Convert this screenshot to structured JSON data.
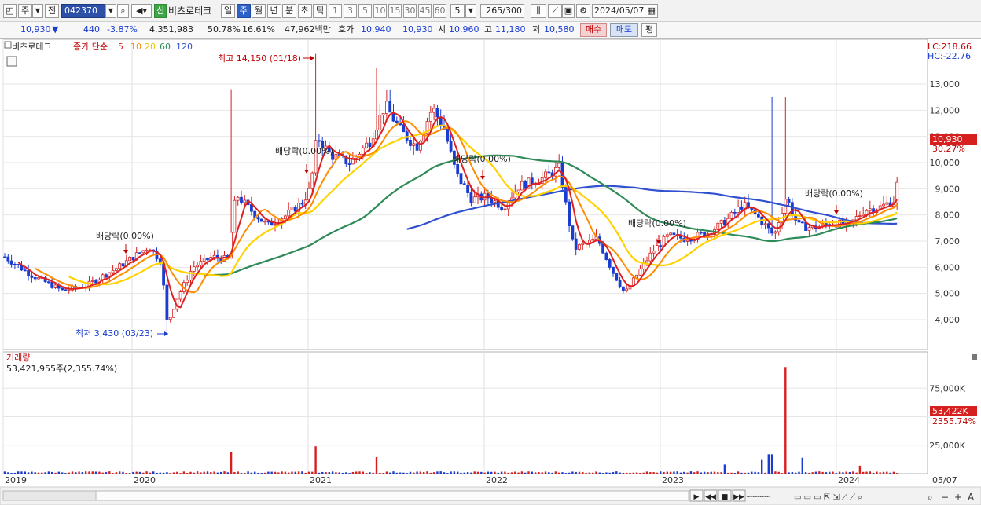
{
  "toolbar": {
    "type_sel": "주",
    "prev_btn": "전",
    "code": "042370",
    "new_badge": "신",
    "stock_name": "비츠로테크",
    "periods": [
      "일",
      "주",
      "월",
      "년",
      "분",
      "초",
      "틱"
    ],
    "active_period": "주",
    "minute_opts": [
      "1",
      "3",
      "5",
      "10",
      "15",
      "30",
      "45",
      "60"
    ],
    "custom_n": "5",
    "count": "265",
    "count_max": "/300",
    "date": "2024/05/07"
  },
  "quote": {
    "price": "10,930",
    "change": "440",
    "change_pct": "-3.87%",
    "volume": "4,351,983",
    "vol_ratio": "50.78%",
    "turnover": "16.61%",
    "amount": "47,962백만",
    "hoga_label": "호가",
    "ask": "10,940",
    "bid": "10,930",
    "open_label": "시",
    "open": "10,960",
    "high_label": "고",
    "high": "11,180",
    "low_label": "저",
    "low": "10,580",
    "buy_btn": "매수",
    "sell_btn": "매도",
    "eval_btn": "평"
  },
  "legend": {
    "name": "비츠로테크",
    "ma_label": "종가 단순",
    "ma_periods": [
      "5",
      "10",
      "20",
      "60",
      "120"
    ],
    "ma_colors": [
      "#e02020",
      "#ff8c00",
      "#ffd200",
      "#2e8b57",
      "#3050d0"
    ]
  },
  "scale": {
    "lc": "LC:218.66",
    "hc": "HC:-22.76"
  },
  "price_axis": [
    "13,000",
    "12,000",
    "11,000",
    "10,000",
    "9,000",
    "8,000",
    "7,000",
    "6,000",
    "5,000",
    "4,000"
  ],
  "price_tag": {
    "value": "10,930",
    "pct": "30.27%"
  },
  "annotations": {
    "high": "최고 14,150 (01/18)",
    "low": "최저 3,430 (03/23)",
    "dividends": [
      "배당락(0.00%)",
      "배당락(0.00%)",
      "배당락(0.00%)",
      "배당락(0.00%)",
      "배당락(0.00%)"
    ]
  },
  "volume": {
    "title": "거래량",
    "value": "53,421,955주(2,355.74%)",
    "axis": [
      "75,000K",
      "50,000K",
      "25,000K"
    ],
    "tag": {
      "value": "53,422K",
      "pct": "2355.74%"
    }
  },
  "x_axis": [
    "2019",
    "2020",
    "2021",
    "2022",
    "2023",
    "2024",
    "05/07"
  ],
  "chart_data": {
    "type": "line",
    "x": [
      "2019-01",
      "2019-06",
      "2019-12",
      "2020-03",
      "2020-06",
      "2020-09",
      "2021-01",
      "2021-06",
      "2021-09",
      "2022-01",
      "2022-06",
      "2022-09",
      "2022-12",
      "2023-03",
      "2023-06",
      "2023-09",
      "2024-01",
      "2024-04",
      "2024-05"
    ],
    "series": [
      {
        "values": [
          6400,
          5200,
          6500,
          3430,
          6200,
          8000,
          14150,
          11500,
          11800,
          8500,
          9300,
          5000,
          6500,
          7500,
          8200,
          7700,
          8000,
          8700,
          10930
        ]
      }
    ],
    "ylim": [
      3000,
      14200
    ]
  },
  "bottom_controls": [
    "▶",
    "◀◀",
    "■",
    "▶▶"
  ]
}
